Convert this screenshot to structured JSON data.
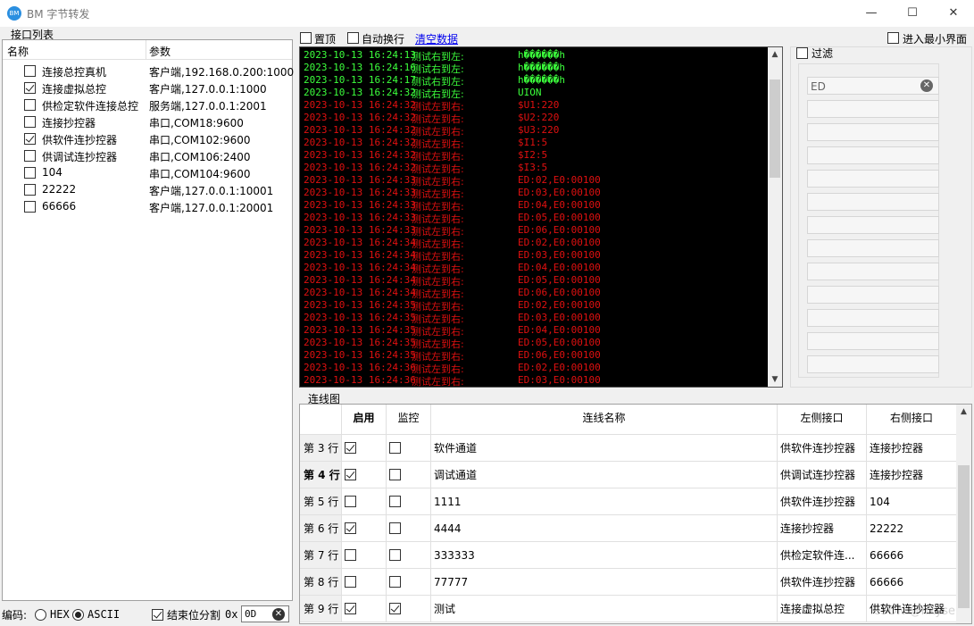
{
  "window": {
    "title": "BM 字节转发",
    "icon": "app-logo-icon",
    "minimize": "—",
    "maximize": "☐",
    "close": "✕"
  },
  "port_list": {
    "legend": "接口列表",
    "col_name": "名称",
    "col_param": "参数",
    "items": [
      {
        "name": "连接总控真机",
        "param": "客户端,192.168.0.200:1000",
        "checked": false
      },
      {
        "name": "连接虚拟总控",
        "param": "客户端,127.0.0.1:1000",
        "checked": true
      },
      {
        "name": "供检定软件连接总控",
        "param": "服务端,127.0.0.1:2001",
        "checked": false
      },
      {
        "name": "连接抄控器",
        "param": "串口,COM18:9600",
        "checked": false
      },
      {
        "name": "供软件连抄控器",
        "param": "串口,COM102:9600",
        "checked": true
      },
      {
        "name": "供调试连抄控器",
        "param": "串口,COM106:2400",
        "checked": false
      },
      {
        "name": "104",
        "param": "串口,COM104:9600",
        "checked": false
      },
      {
        "name": "22222",
        "param": "客户端,127.0.0.1:10001",
        "checked": false
      },
      {
        "name": "66666",
        "param": "客户端,127.0.0.1:20001",
        "checked": false
      }
    ]
  },
  "encoding": {
    "label": "编码:",
    "hex": "HEX",
    "ascii": "ASCII",
    "selected": "ASCII",
    "split_label": "结束位分割",
    "split_checked": true,
    "prefix": "0x",
    "value": "0D"
  },
  "toolbar": {
    "pin": "置顶",
    "autowrap": "自动换行",
    "clear": "清空数据",
    "minimize_mode": "进入最小界面"
  },
  "filter": {
    "label": "过滤",
    "first_value": "ED"
  },
  "colors": {
    "green": "#3cff3c",
    "red": "#e01010",
    "console_bg": "#000000",
    "link": "#0000ee"
  },
  "log": [
    {
      "ts": "2023-10-13 16:24:13",
      "dir": "测试右到左:",
      "data": "h������h",
      "color": "green"
    },
    {
      "ts": "2023-10-13 16:24:16",
      "dir": "测试右到左:",
      "data": "h������h",
      "color": "green"
    },
    {
      "ts": "2023-10-13 16:24:17",
      "dir": "测试右到左:",
      "data": "h������h",
      "color": "green"
    },
    {
      "ts": "2023-10-13 16:24:32",
      "dir": "测试右到左:",
      "data": "UION",
      "color": "green"
    },
    {
      "ts": "2023-10-13 16:24:32",
      "dir": "测试左到右:",
      "data": "$U1:220",
      "color": "red"
    },
    {
      "ts": "2023-10-13 16:24:32",
      "dir": "测试左到右:",
      "data": "$U2:220",
      "color": "red"
    },
    {
      "ts": "2023-10-13 16:24:32",
      "dir": "测试左到右:",
      "data": "$U3:220",
      "color": "red"
    },
    {
      "ts": "2023-10-13 16:24:32",
      "dir": "测试左到右:",
      "data": "$I1:5",
      "color": "red"
    },
    {
      "ts": "2023-10-13 16:24:32",
      "dir": "测试左到右:",
      "data": "$I2:5",
      "color": "red"
    },
    {
      "ts": "2023-10-13 16:24:32",
      "dir": "测试左到右:",
      "data": "$I3:5",
      "color": "red"
    },
    {
      "ts": "2023-10-13 16:24:33",
      "dir": "测试左到右:",
      "data": "ED:02,E0:00100",
      "color": "red"
    },
    {
      "ts": "2023-10-13 16:24:33",
      "dir": "测试左到右:",
      "data": "ED:03,E0:00100",
      "color": "red"
    },
    {
      "ts": "2023-10-13 16:24:33",
      "dir": "测试左到右:",
      "data": "ED:04,E0:00100",
      "color": "red"
    },
    {
      "ts": "2023-10-13 16:24:33",
      "dir": "测试左到右:",
      "data": "ED:05,E0:00100",
      "color": "red"
    },
    {
      "ts": "2023-10-13 16:24:33",
      "dir": "测试左到右:",
      "data": "ED:06,E0:00100",
      "color": "red"
    },
    {
      "ts": "2023-10-13 16:24:34",
      "dir": "测试左到右:",
      "data": "ED:02,E0:00100",
      "color": "red"
    },
    {
      "ts": "2023-10-13 16:24:34",
      "dir": "测试左到右:",
      "data": "ED:03,E0:00100",
      "color": "red"
    },
    {
      "ts": "2023-10-13 16:24:34",
      "dir": "测试左到右:",
      "data": "ED:04,E0:00100",
      "color": "red"
    },
    {
      "ts": "2023-10-13 16:24:34",
      "dir": "测试左到右:",
      "data": "ED:05,E0:00100",
      "color": "red"
    },
    {
      "ts": "2023-10-13 16:24:34",
      "dir": "测试左到右:",
      "data": "ED:06,E0:00100",
      "color": "red"
    },
    {
      "ts": "2023-10-13 16:24:35",
      "dir": "测试左到右:",
      "data": "ED:02,E0:00100",
      "color": "red"
    },
    {
      "ts": "2023-10-13 16:24:35",
      "dir": "测试左到右:",
      "data": "ED:03,E0:00100",
      "color": "red"
    },
    {
      "ts": "2023-10-13 16:24:35",
      "dir": "测试左到右:",
      "data": "ED:04,E0:00100",
      "color": "red"
    },
    {
      "ts": "2023-10-13 16:24:35",
      "dir": "测试左到右:",
      "data": "ED:05,E0:00100",
      "color": "red"
    },
    {
      "ts": "2023-10-13 16:24:35",
      "dir": "测试左到右:",
      "data": "ED:06,E0:00100",
      "color": "red"
    },
    {
      "ts": "2023-10-13 16:24:36",
      "dir": "测试左到右:",
      "data": "ED:02,E0:00100",
      "color": "red"
    },
    {
      "ts": "2023-10-13 16:24:36",
      "dir": "测试左到右:",
      "data": "ED:03,E0:00100",
      "color": "red"
    }
  ],
  "connections": {
    "legend": "连线图",
    "headers": {
      "enable": "启用",
      "monitor": "监控",
      "name": "连线名称",
      "left": "左侧接口",
      "right": "右侧接口"
    },
    "rows": [
      {
        "row": "第 3 行",
        "enabled": true,
        "monitor": false,
        "name": "软件通道",
        "left": "供软件连抄控器",
        "right": "连接抄控器",
        "bold": false
      },
      {
        "row": "第 4 行",
        "enabled": true,
        "monitor": false,
        "name": "调试通道",
        "left": "供调试连抄控器",
        "right": "连接抄控器",
        "bold": true
      },
      {
        "row": "第 5 行",
        "enabled": false,
        "monitor": false,
        "name": "1111",
        "left": "供软件连抄控器",
        "right": "104",
        "bold": false
      },
      {
        "row": "第 6 行",
        "enabled": true,
        "monitor": false,
        "name": "4444",
        "left": "连接抄控器",
        "right": "22222",
        "bold": false
      },
      {
        "row": "第 7 行",
        "enabled": false,
        "monitor": false,
        "name": "333333",
        "left": "供检定软件连...",
        "right": "66666",
        "bold": false
      },
      {
        "row": "第 8 行",
        "enabled": false,
        "monitor": false,
        "name": "77777",
        "left": "供软件连抄控器",
        "right": "66666",
        "bold": false
      },
      {
        "row": "第 9 行",
        "enabled": true,
        "monitor": true,
        "name": "测试",
        "left": "连接虚拟总控",
        "right": "供软件连抄控器",
        "bold": false
      }
    ]
  },
  "watermark": "CSDN @nxyse"
}
